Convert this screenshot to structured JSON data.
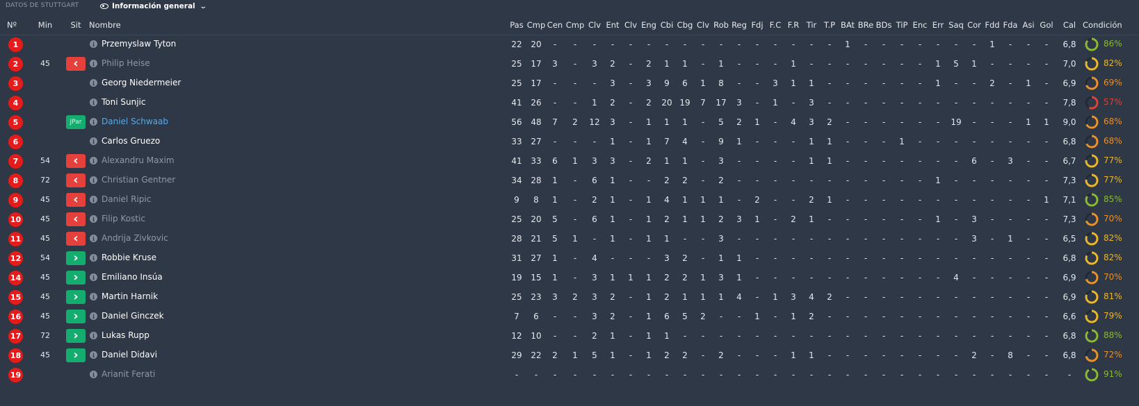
{
  "header": {
    "club_label": "DATOS DE STUTTGART",
    "view_label": "Información general",
    "eye_icon": "eye-icon",
    "dropdown_icon": "chevron-down-icon"
  },
  "columns": {
    "num": "Nº",
    "min": "Min",
    "sit": "Sit",
    "name": "Nombre",
    "stats": [
      "Pas",
      "Cmp",
      "Cen",
      "Cmp",
      "Clv",
      "Ent",
      "Clv",
      "Eng",
      "Cbi",
      "Cbg",
      "Clv",
      "Rob",
      "Reg",
      "Fdj",
      "F.C",
      "F.R",
      "Tir",
      "T.P",
      "BAt",
      "BRe",
      "BDs",
      "TiP",
      "Enc",
      "Err",
      "Saq",
      "Cor",
      "Fdd",
      "Fda",
      "Asi",
      "Gol",
      "Cal"
    ],
    "condition": "Condición"
  },
  "colors": {
    "background": "#2e3847",
    "number_badge": "#e51c1c",
    "sub_off": "#e5403b",
    "sub_on": "#14ad6f",
    "cond_green": "#8bb836",
    "cond_yellow": "#e8b72d",
    "cond_orange": "#e8912d",
    "cond_red": "#d9443c",
    "link": "#5aa9e6"
  },
  "players": [
    {
      "num": "1",
      "min": "",
      "sit": "",
      "name": "Przemyslaw Tyton",
      "state": "active",
      "stats": [
        "22",
        "20",
        "-",
        "-",
        "-",
        "-",
        "-",
        "-",
        "-",
        "-",
        "-",
        "-",
        "-",
        "-",
        "-",
        "-",
        "-",
        "-",
        "1",
        "-",
        "-",
        "-",
        "-",
        "-",
        "-",
        "-",
        "1",
        "-",
        "-",
        "-",
        "6,8"
      ],
      "cond": 86
    },
    {
      "num": "2",
      "min": "45",
      "sit": "off",
      "name": "Philip Heise",
      "state": "dim",
      "stats": [
        "25",
        "17",
        "3",
        "-",
        "3",
        "2",
        "-",
        "2",
        "1",
        "1",
        "-",
        "1",
        "-",
        "-",
        "-",
        "1",
        "-",
        "-",
        "-",
        "-",
        "-",
        "-",
        "-",
        "1",
        "5",
        "1",
        "-",
        "-",
        "-",
        "-",
        "7,0"
      ],
      "cond": 82
    },
    {
      "num": "3",
      "min": "",
      "sit": "",
      "name": "Georg Niedermeier",
      "state": "active",
      "stats": [
        "25",
        "17",
        "-",
        "-",
        "-",
        "3",
        "-",
        "3",
        "9",
        "6",
        "1",
        "8",
        "-",
        "-",
        "3",
        "1",
        "1",
        "-",
        "-",
        "-",
        "-",
        "-",
        "-",
        "1",
        "-",
        "-",
        "2",
        "-",
        "1",
        "-",
        "6,9"
      ],
      "cond": 69
    },
    {
      "num": "4",
      "min": "",
      "sit": "",
      "name": "Toni Sunjic",
      "state": "active",
      "stats": [
        "41",
        "26",
        "-",
        "-",
        "1",
        "2",
        "-",
        "2",
        "20",
        "19",
        "7",
        "17",
        "3",
        "-",
        "1",
        "-",
        "3",
        "-",
        "-",
        "-",
        "-",
        "-",
        "-",
        "-",
        "-",
        "-",
        "-",
        "-",
        "-",
        "-",
        "7,8"
      ],
      "cond": 57
    },
    {
      "num": "5",
      "min": "",
      "sit": "JPar",
      "name": "Daniel Schwaab",
      "state": "link",
      "stats": [
        "56",
        "48",
        "7",
        "2",
        "12",
        "3",
        "-",
        "1",
        "1",
        "1",
        "-",
        "5",
        "2",
        "1",
        "-",
        "4",
        "3",
        "2",
        "-",
        "-",
        "-",
        "-",
        "-",
        "-",
        "19",
        "-",
        "-",
        "-",
        "1",
        "1",
        "9,0"
      ],
      "cond": 68
    },
    {
      "num": "6",
      "min": "",
      "sit": "",
      "name": "Carlos Gruezo",
      "state": "active",
      "stats": [
        "33",
        "27",
        "-",
        "-",
        "-",
        "1",
        "-",
        "1",
        "7",
        "4",
        "-",
        "9",
        "1",
        "-",
        "-",
        "-",
        "1",
        "1",
        "-",
        "-",
        "-",
        "1",
        "-",
        "-",
        "-",
        "-",
        "-",
        "-",
        "-",
        "-",
        "6,8"
      ],
      "cond": 68
    },
    {
      "num": "7",
      "min": "54",
      "sit": "off",
      "name": "Alexandru Maxim",
      "state": "dim",
      "stats": [
        "41",
        "33",
        "6",
        "1",
        "3",
        "3",
        "-",
        "2",
        "1",
        "1",
        "-",
        "3",
        "-",
        "-",
        "-",
        "-",
        "1",
        "1",
        "-",
        "-",
        "-",
        "-",
        "-",
        "-",
        "-",
        "6",
        "-",
        "3",
        "-",
        "-",
        "6,7"
      ],
      "cond": 77
    },
    {
      "num": "8",
      "min": "72",
      "sit": "off",
      "name": "Christian Gentner",
      "state": "dim",
      "stats": [
        "34",
        "28",
        "1",
        "-",
        "6",
        "1",
        "-",
        "-",
        "2",
        "2",
        "-",
        "2",
        "-",
        "-",
        "-",
        "-",
        "-",
        "-",
        "-",
        "-",
        "-",
        "-",
        "-",
        "1",
        "-",
        "-",
        "-",
        "-",
        "-",
        "-",
        "7,3"
      ],
      "cond": 77
    },
    {
      "num": "9",
      "min": "45",
      "sit": "off",
      "name": "Daniel Ripic",
      "state": "dim",
      "stats": [
        "9",
        "8",
        "1",
        "-",
        "2",
        "1",
        "-",
        "1",
        "4",
        "1",
        "1",
        "1",
        "-",
        "2",
        "-",
        "-",
        "2",
        "1",
        "-",
        "-",
        "-",
        "-",
        "-",
        "-",
        "-",
        "-",
        "-",
        "-",
        "-",
        "1",
        "7,1"
      ],
      "cond": 85
    },
    {
      "num": "10",
      "min": "45",
      "sit": "off",
      "name": "Filip Kostic",
      "state": "dim",
      "stats": [
        "25",
        "20",
        "5",
        "-",
        "6",
        "1",
        "-",
        "1",
        "2",
        "1",
        "1",
        "2",
        "3",
        "1",
        "-",
        "2",
        "1",
        "-",
        "-",
        "-",
        "-",
        "-",
        "-",
        "1",
        "-",
        "3",
        "-",
        "-",
        "-",
        "-",
        "7,3"
      ],
      "cond": 70
    },
    {
      "num": "11",
      "min": "45",
      "sit": "off",
      "name": "Andrija Zivkovic",
      "state": "dim",
      "stats": [
        "28",
        "21",
        "5",
        "1",
        "-",
        "1",
        "-",
        "1",
        "1",
        "-",
        "-",
        "3",
        "-",
        "-",
        "-",
        "-",
        "-",
        "-",
        "-",
        "-",
        "-",
        "-",
        "-",
        "-",
        "-",
        "3",
        "-",
        "1",
        "-",
        "-",
        "6,5"
      ],
      "cond": 82
    },
    {
      "num": "12",
      "min": "54",
      "sit": "on",
      "name": "Robbie Kruse",
      "state": "active",
      "stats": [
        "31",
        "27",
        "1",
        "-",
        "4",
        "-",
        "-",
        "-",
        "3",
        "2",
        "-",
        "1",
        "1",
        "-",
        "-",
        "-",
        "-",
        "-",
        "-",
        "-",
        "-",
        "-",
        "-",
        "-",
        "-",
        "-",
        "-",
        "-",
        "-",
        "-",
        "6,8"
      ],
      "cond": 82
    },
    {
      "num": "14",
      "min": "45",
      "sit": "on",
      "name": "Emiliano Insúa",
      "state": "active",
      "stats": [
        "19",
        "15",
        "1",
        "-",
        "3",
        "1",
        "1",
        "1",
        "2",
        "2",
        "1",
        "3",
        "1",
        "-",
        "-",
        "-",
        "-",
        "-",
        "-",
        "-",
        "-",
        "-",
        "-",
        "-",
        "4",
        "-",
        "-",
        "-",
        "-",
        "-",
        "6,9"
      ],
      "cond": 70
    },
    {
      "num": "15",
      "min": "45",
      "sit": "on",
      "name": "Martin Harnik",
      "state": "active",
      "stats": [
        "25",
        "23",
        "3",
        "2",
        "3",
        "2",
        "-",
        "1",
        "2",
        "1",
        "1",
        "1",
        "4",
        "-",
        "1",
        "3",
        "4",
        "2",
        "-",
        "-",
        "-",
        "-",
        "-",
        "-",
        "-",
        "-",
        "-",
        "-",
        "-",
        "-",
        "6,9"
      ],
      "cond": 81
    },
    {
      "num": "16",
      "min": "45",
      "sit": "on",
      "name": "Daniel Ginczek",
      "state": "active",
      "stats": [
        "7",
        "6",
        "-",
        "-",
        "3",
        "2",
        "-",
        "1",
        "6",
        "5",
        "2",
        "-",
        "-",
        "1",
        "-",
        "1",
        "2",
        "-",
        "-",
        "-",
        "-",
        "-",
        "-",
        "-",
        "-",
        "-",
        "-",
        "-",
        "-",
        "-",
        "6,6"
      ],
      "cond": 79
    },
    {
      "num": "17",
      "min": "72",
      "sit": "on",
      "name": "Lukas Rupp",
      "state": "active",
      "stats": [
        "12",
        "10",
        "-",
        "-",
        "2",
        "1",
        "-",
        "1",
        "1",
        "-",
        "-",
        "-",
        "-",
        "-",
        "-",
        "-",
        "-",
        "-",
        "-",
        "-",
        "-",
        "-",
        "-",
        "-",
        "-",
        "-",
        "-",
        "-",
        "-",
        "-",
        "6,8"
      ],
      "cond": 88
    },
    {
      "num": "18",
      "min": "45",
      "sit": "on",
      "name": "Daniel Didavi",
      "state": "active",
      "stats": [
        "29",
        "22",
        "2",
        "1",
        "5",
        "1",
        "-",
        "1",
        "2",
        "2",
        "-",
        "2",
        "-",
        "-",
        "-",
        "1",
        "1",
        "-",
        "-",
        "-",
        "-",
        "-",
        "-",
        "-",
        "-",
        "2",
        "-",
        "8",
        "-",
        "-",
        "6,8"
      ],
      "cond": 72
    },
    {
      "num": "19",
      "min": "",
      "sit": "",
      "name": "Arianit Ferati",
      "state": "dim",
      "stats": [
        "-",
        "-",
        "-",
        "-",
        "-",
        "-",
        "-",
        "-",
        "-",
        "-",
        "-",
        "-",
        "-",
        "-",
        "-",
        "-",
        "-",
        "-",
        "-",
        "-",
        "-",
        "-",
        "-",
        "-",
        "-",
        "-",
        "-",
        "-",
        "-",
        "-",
        "-"
      ],
      "cond": 91
    }
  ]
}
